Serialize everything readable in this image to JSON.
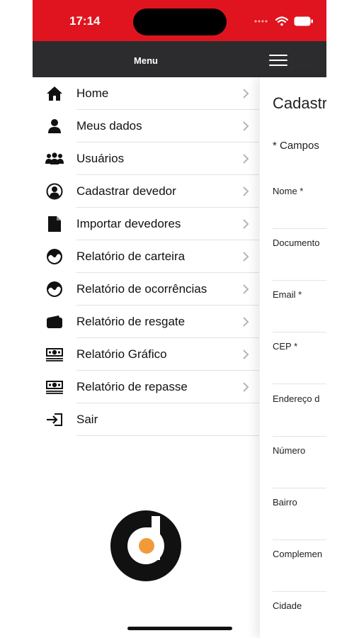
{
  "status_bar": {
    "time": "17:14"
  },
  "header": {
    "title": "Menu"
  },
  "menu": {
    "items": [
      {
        "label": "Home",
        "icon": "home-icon"
      },
      {
        "label": "Meus dados",
        "icon": "user-icon"
      },
      {
        "label": "Usuários",
        "icon": "users-icon"
      },
      {
        "label": "Cadastrar devedor",
        "icon": "user-circle-icon"
      },
      {
        "label": "Importar devedores",
        "icon": "document-icon"
      },
      {
        "label": "Relatório de carteira",
        "icon": "chart-circle-icon"
      },
      {
        "label": "Relatório de ocorrências",
        "icon": "chart-circle-icon"
      },
      {
        "label": "Relatório de resgate",
        "icon": "wallet-icon"
      },
      {
        "label": "Relatório Gráfico",
        "icon": "money-icon"
      },
      {
        "label": "Relatório de repasse",
        "icon": "money-icon"
      },
      {
        "label": "Sair",
        "icon": "logout-icon"
      }
    ]
  },
  "form": {
    "title": "Cadastr",
    "required_note": "* Campos",
    "fields": [
      "Nome *",
      "Documento",
      "Email *",
      "CEP *",
      "Endereço d",
      "Número",
      "Bairro",
      "Complemen",
      "Cidade"
    ]
  },
  "colors": {
    "status_bar": "#e0141e",
    "header": "#2c2c2e",
    "logo_accent": "#f29a3a"
  }
}
